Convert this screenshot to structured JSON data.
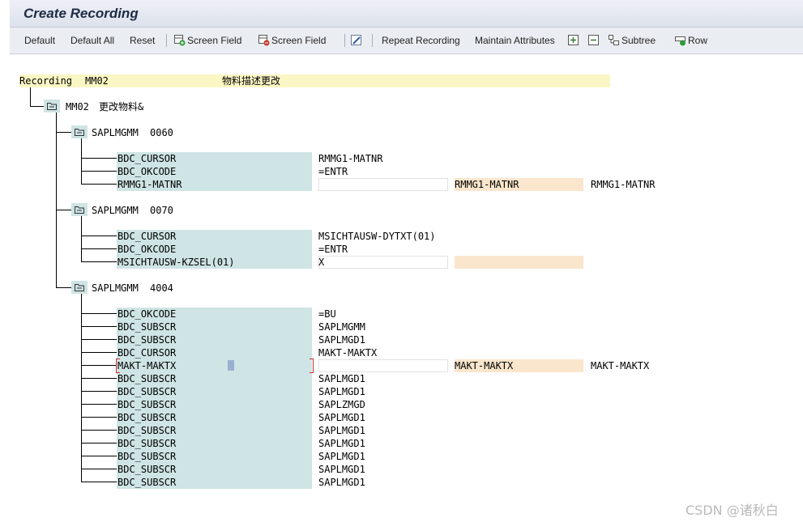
{
  "window": {
    "title": "Create Recording"
  },
  "toolbar": {
    "default_label": "Default",
    "default_all_label": "Default All",
    "reset_label": "Reset",
    "screen_field_insert_label": "Screen Field",
    "screen_field_delete_label": "Screen Field",
    "repeat_recording_label": "Repeat Recording",
    "maintain_attributes_label": "Maintain Attributes",
    "subtree_label": "Subtree",
    "row_label": "Row"
  },
  "recording": {
    "label": "Recording",
    "name": "MM02",
    "description": "物料描述更改",
    "transaction": {
      "code": "MM02",
      "text": "更改物料&"
    },
    "screens": [
      {
        "program": "SAPLMGMM",
        "number": "0060",
        "fields": [
          {
            "name": "BDC_CURSOR",
            "value": "RMMG1-MATNR"
          },
          {
            "name": "BDC_OKCODE",
            "value": "=ENTR"
          },
          {
            "name": "RMMG1-MATNR",
            "value": "",
            "ref": "RMMG1-MATNR",
            "extra": "RMMG1-MATNR"
          }
        ]
      },
      {
        "program": "SAPLMGMM",
        "number": "0070",
        "fields": [
          {
            "name": "BDC_CURSOR",
            "value": "MSICHTAUSW-DYTXT(01)"
          },
          {
            "name": "BDC_OKCODE",
            "value": "=ENTR"
          },
          {
            "name": "MSICHTAUSW-KZSEL(01)",
            "value": "X",
            "ref": "",
            "extra": ""
          }
        ]
      },
      {
        "program": "SAPLMGMM",
        "number": "4004",
        "fields": [
          {
            "name": "BDC_OKCODE",
            "value": "=BU"
          },
          {
            "name": "BDC_SUBSCR",
            "value": "SAPLMGMM"
          },
          {
            "name": "BDC_SUBSCR",
            "value": "SAPLMGD1"
          },
          {
            "name": "BDC_CURSOR",
            "value": "MAKT-MAKTX"
          },
          {
            "name": "MAKT-MAKTX",
            "value": "",
            "ref": "MAKT-MAKTX",
            "extra": "MAKT-MAKTX"
          },
          {
            "name": "BDC_SUBSCR",
            "value": "SAPLMGD1"
          },
          {
            "name": "BDC_SUBSCR",
            "value": "SAPLMGD1"
          },
          {
            "name": "BDC_SUBSCR",
            "value": "SAPLZMGD"
          },
          {
            "name": "BDC_SUBSCR",
            "value": "SAPLMGD1"
          },
          {
            "name": "BDC_SUBSCR",
            "value": "SAPLMGD1"
          },
          {
            "name": "BDC_SUBSCR",
            "value": "SAPLMGD1"
          },
          {
            "name": "BDC_SUBSCR",
            "value": "SAPLMGD1"
          },
          {
            "name": "BDC_SUBSCR",
            "value": "SAPLMGD1"
          },
          {
            "name": "BDC_SUBSCR",
            "value": "SAPLMGD1"
          }
        ]
      }
    ]
  },
  "watermark": "CSDN @诸秋白",
  "colors": {
    "field_bg": "#cfe4e4",
    "header_bg": "#fbf7c4",
    "ref_bg": "#fae6cc",
    "toolbar_bg": "#eaedf2"
  }
}
